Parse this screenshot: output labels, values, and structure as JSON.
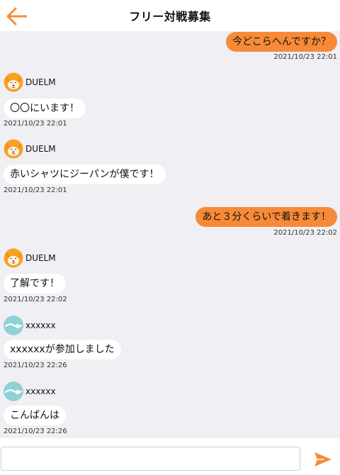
{
  "header": {
    "title": "フリー対戦募集",
    "back_icon": "back-arrow-icon",
    "accent_color": "#f78a38"
  },
  "messages": [
    {
      "side": "mine",
      "text": "今どこらへんですか？",
      "time": "2021/10/23 22:01"
    },
    {
      "side": "theirs",
      "sender": "DUELM",
      "avatar": "fox-mascot-icon",
      "text": "〇〇にいます！",
      "time": "2021/10/23 22:01"
    },
    {
      "side": "theirs",
      "sender": "DUELM",
      "avatar": "fox-mascot-icon",
      "text": "赤いシャツにジーパンが僕です！",
      "time": "2021/10/23 22:01"
    },
    {
      "side": "mine",
      "text": "あと３分くらいで着きます！",
      "time": "2021/10/23 22:02"
    },
    {
      "side": "theirs",
      "sender": "DUELM",
      "avatar": "fox-mascot-icon",
      "text": "了解です！",
      "time": "2021/10/23 22:02"
    },
    {
      "side": "theirs",
      "sender": "xxxxxx",
      "avatar": "default-user-icon",
      "text": "xxxxxxが参加しました",
      "time": "2021/10/23 22:26"
    },
    {
      "side": "theirs",
      "sender": "xxxxxx",
      "avatar": "default-user-icon",
      "text": "こんばんは",
      "time": "2021/10/23 22:26"
    }
  ],
  "input": {
    "value": "",
    "placeholder": "",
    "send_icon": "send-icon"
  }
}
